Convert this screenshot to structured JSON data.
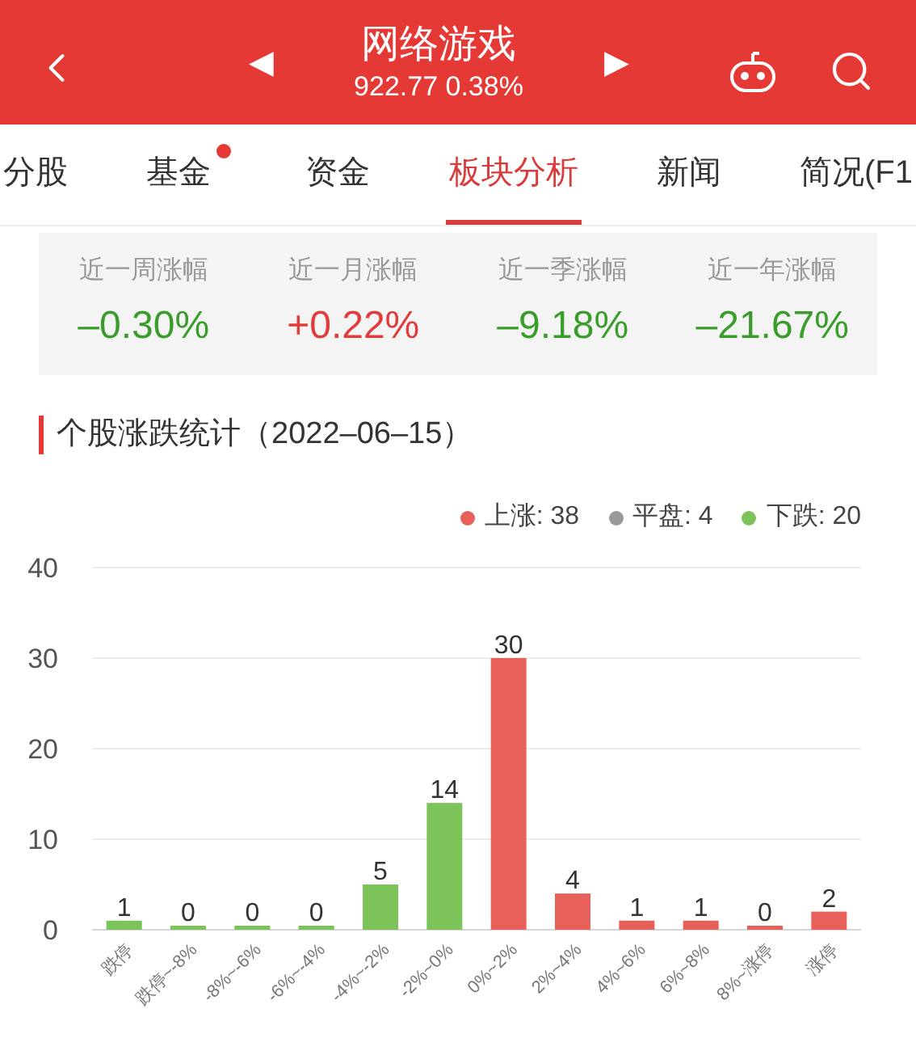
{
  "header": {
    "prev": "◀",
    "title": "网络游戏",
    "subtitle": "922.77 0.38%",
    "next": "▶"
  },
  "tabs": [
    {
      "label": "分股",
      "selected": false,
      "dot": false
    },
    {
      "label": "基金",
      "selected": false,
      "dot": true
    },
    {
      "label": "资金",
      "selected": false,
      "dot": false
    },
    {
      "label": "板块分析",
      "selected": true,
      "dot": false
    },
    {
      "label": "新闻",
      "selected": false,
      "dot": false
    },
    {
      "label": "简况(F1",
      "selected": false,
      "dot": false
    }
  ],
  "stats": [
    {
      "label": "近一周涨幅",
      "value": "–0.30%",
      "color": "#3a9c2a"
    },
    {
      "label": "近一月涨幅",
      "value": "+0.22%",
      "color": "#e03c3c"
    },
    {
      "label": "近一季涨幅",
      "value": "–9.18%",
      "color": "#3a9c2a"
    },
    {
      "label": "近一年涨幅",
      "value": "–21.67%",
      "color": "#3a9c2a"
    }
  ],
  "section_title": "个股涨跌统计（2022–06–15）",
  "legend": [
    {
      "label": "上涨: 38",
      "color": "#e8605a"
    },
    {
      "label": "平盘: 4",
      "color": "#999999"
    },
    {
      "label": "下跌: 20",
      "color": "#7cc45a"
    }
  ],
  "chart_data": {
    "type": "bar",
    "categories": [
      "跌停",
      "跌停~-8%",
      "-8%~-6%",
      "-6%~-4%",
      "-4%~-2%",
      "-2%~0%",
      "0%~2%",
      "2%~4%",
      "4%~6%",
      "6%~8%",
      "8%~涨停",
      "涨停"
    ],
    "series": [
      {
        "color": "#7cc45a",
        "values": [
          1,
          0,
          0,
          0,
          5,
          14,
          null,
          null,
          null,
          null,
          null,
          null
        ]
      },
      {
        "color": "#e8605a",
        "values": [
          null,
          null,
          null,
          null,
          null,
          null,
          30,
          4,
          1,
          1,
          0,
          2
        ]
      }
    ],
    "ylim": [
      0,
      40
    ],
    "yticks": [
      0,
      10,
      20,
      30,
      40
    ],
    "grid": true,
    "data_labels": true
  }
}
